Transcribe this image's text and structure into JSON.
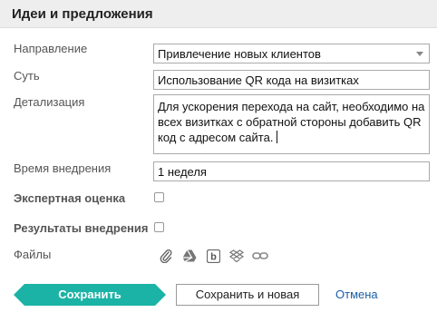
{
  "header": {
    "title": "Идеи и предложения"
  },
  "form": {
    "direction": {
      "label": "Направление",
      "value": "Привлечение новых клиентов"
    },
    "essence": {
      "label": "Суть",
      "value": "Использование QR кода на визитках"
    },
    "details": {
      "label": "Детализация",
      "lines": [
        "Для ускорения перехода на сайт, необходимо на",
        "всех визитках с обратной стороны добавить QR",
        "код с адресом сайта."
      ]
    },
    "time": {
      "label": "Время внедрения",
      "value": "1 неделя"
    },
    "expert": {
      "label": "Экспертная оценка"
    },
    "results": {
      "label": "Результаты внедрения"
    },
    "files": {
      "label": "Файлы",
      "icons": [
        "paperclip-icon",
        "google-drive-icon",
        "box-icon",
        "dropbox-icon",
        "link-icon"
      ]
    }
  },
  "actions": {
    "save": "Сохранить",
    "save_new": "Сохранить и новая",
    "cancel": "Отмена"
  },
  "colors": {
    "accent": "#1bb3a5",
    "link": "#1a5fa8",
    "header_bg": "#eeeeee"
  }
}
